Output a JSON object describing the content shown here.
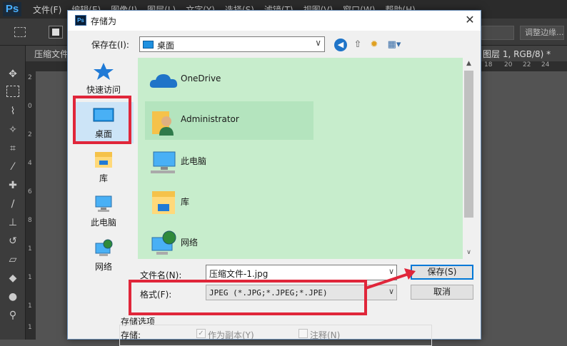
{
  "photoshop": {
    "logo": "Ps",
    "menu": [
      "文件(F)",
      "编辑(E)",
      "图像(I)",
      "图层(L)",
      "文字(Y)",
      "选择(S)",
      "滤镜(T)",
      "视图(V)",
      "窗口(W)",
      "帮助(H)"
    ],
    "refine_edge": "调整边缘...",
    "tab_left": "压缩文件",
    "tab_right": "图层 1, RGB/8) *",
    "ruler_top": [
      "18",
      "20",
      "22",
      "24"
    ],
    "ruler_left": [
      "2",
      "0",
      "2",
      "4",
      "6",
      "8",
      "1",
      "1",
      "1",
      "1"
    ]
  },
  "dialog": {
    "title": "存储为",
    "close": "✕",
    "save_in_label": "保存在(I):",
    "location": "桌面",
    "places": [
      {
        "label": "快速访问",
        "icon": "star-icon"
      },
      {
        "label": "桌面",
        "icon": "desktop-icon"
      },
      {
        "label": "库",
        "icon": "library-icon"
      },
      {
        "label": "此电脑",
        "icon": "computer-icon"
      },
      {
        "label": "网络",
        "icon": "network-icon"
      }
    ],
    "files": [
      {
        "label": "OneDrive",
        "icon": "onedrive-icon"
      },
      {
        "label": "Administrator",
        "icon": "user-folder-icon"
      },
      {
        "label": "此电脑",
        "icon": "computer-icon"
      },
      {
        "label": "库",
        "icon": "library-icon"
      },
      {
        "label": "网络",
        "icon": "network-icon"
      }
    ],
    "filename_label": "文件名(N):",
    "filename_value": "压缩文件-1.jpg",
    "format_label": "格式(F):",
    "format_value": "JPEG (*.JPG;*.JPEG;*.JPE)",
    "save_button": "保存(S)",
    "cancel_button": "取消",
    "options_title": "存储选项",
    "options_store_label": "存储:",
    "option_as_copy": "作为副本(Y)",
    "option_notes": "注释(N)"
  },
  "colors": {
    "file_area_bg": "#c7edcc",
    "annotation_red": "#e0263a",
    "ps_bg": "#535353"
  }
}
